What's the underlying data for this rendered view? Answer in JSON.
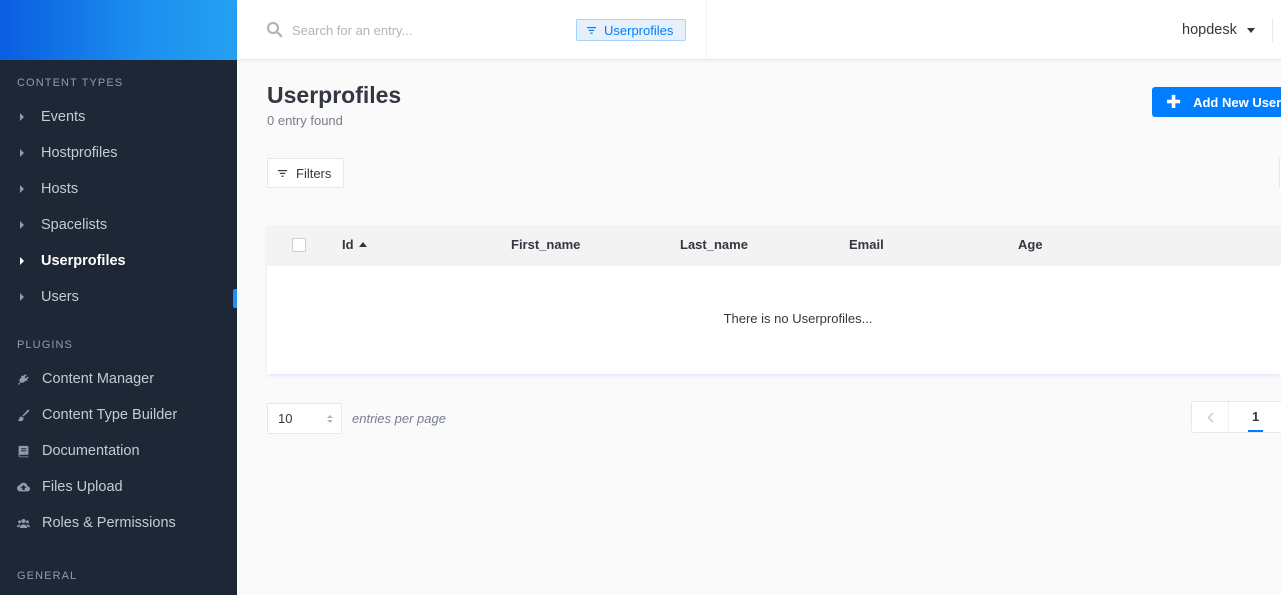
{
  "sidebar": {
    "sections": {
      "content_types": "Content Types",
      "plugins": "Plugins",
      "general": "General"
    },
    "content_types": [
      {
        "label": "Events",
        "active": false
      },
      {
        "label": "Hostprofiles",
        "active": false
      },
      {
        "label": "Hosts",
        "active": false
      },
      {
        "label": "Spacelists",
        "active": false
      },
      {
        "label": "Userprofiles",
        "active": true
      },
      {
        "label": "Users",
        "active": false
      }
    ],
    "plugins": [
      {
        "label": "Content Manager",
        "icon": "plug-icon"
      },
      {
        "label": "Content Type Builder",
        "icon": "brush-icon"
      },
      {
        "label": "Documentation",
        "icon": "book-icon"
      },
      {
        "label": "Files Upload",
        "icon": "cloud-upload-icon"
      },
      {
        "label": "Roles & Permissions",
        "icon": "users-icon"
      }
    ]
  },
  "header": {
    "search_placeholder": "Search for an entry...",
    "search_tag": "Userprofiles",
    "user": "hopdesk"
  },
  "main": {
    "title": "Userprofiles",
    "count": "0 entry found",
    "add_button": "Add New Userprofile",
    "filters_button": "Filters",
    "table": {
      "columns": [
        "Id",
        "First_name",
        "Last_name",
        "Email",
        "Age"
      ],
      "sorted_column": "Id",
      "sort_direction": "asc",
      "empty_message": "There is no Userprofiles..."
    },
    "pagination": {
      "per_page": "10",
      "per_page_label": "entries per page",
      "current_page": "1"
    }
  },
  "colors": {
    "accent": "#007eff",
    "sidebar_bg": "#1e2735",
    "brand_gradient_start": "#0a5de0",
    "brand_gradient_end": "#25a0f2"
  }
}
